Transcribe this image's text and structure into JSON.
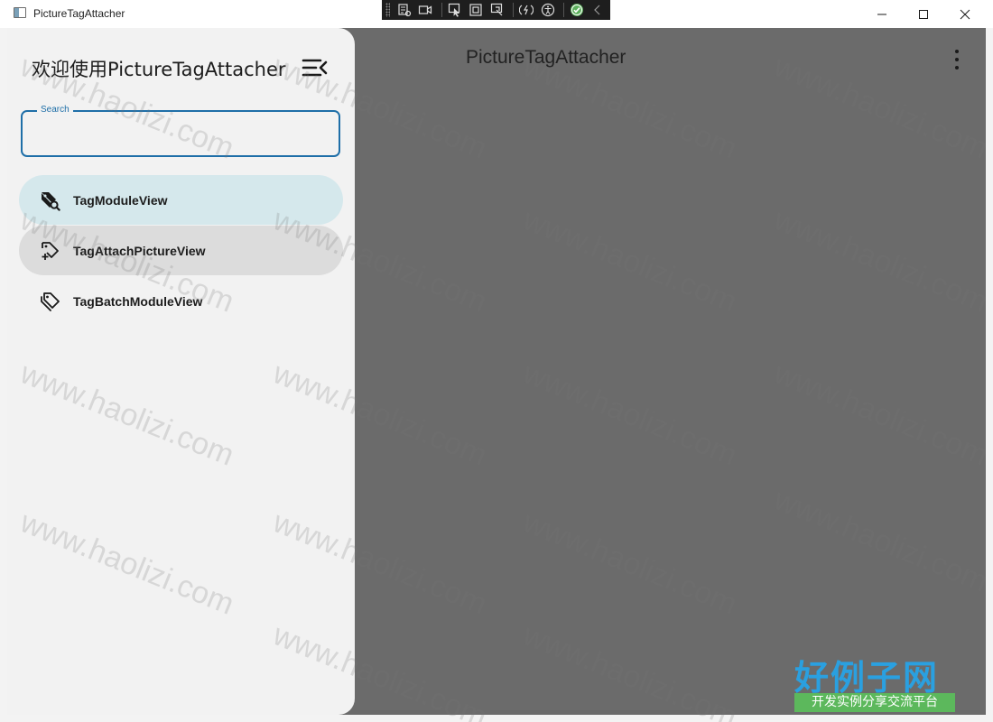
{
  "window": {
    "title": "PictureTagAttacher"
  },
  "app_bar": {
    "title": "PictureTagAttacher"
  },
  "drawer": {
    "title": "欢迎使用PictureTagAttacher",
    "search": {
      "label": "Search",
      "value": ""
    },
    "items": [
      {
        "label": "TagModuleView",
        "icon": "tag-search-icon",
        "state": "selected"
      },
      {
        "label": "TagAttachPictureView",
        "icon": "tag-add-icon",
        "state": "hover"
      },
      {
        "label": "TagBatchModuleView",
        "icon": "tag-multiple-icon",
        "state": "normal"
      }
    ]
  },
  "watermark": {
    "text": "www.haolizi.com",
    "logo_main": "好例子网",
    "logo_sub": "开发实例分享交流平台"
  },
  "colors": {
    "accent": "#1f6fa8",
    "selected_bg": "#d5e8ec",
    "hover_bg": "#dcdcdc",
    "scrim": "#6b6b6b"
  }
}
